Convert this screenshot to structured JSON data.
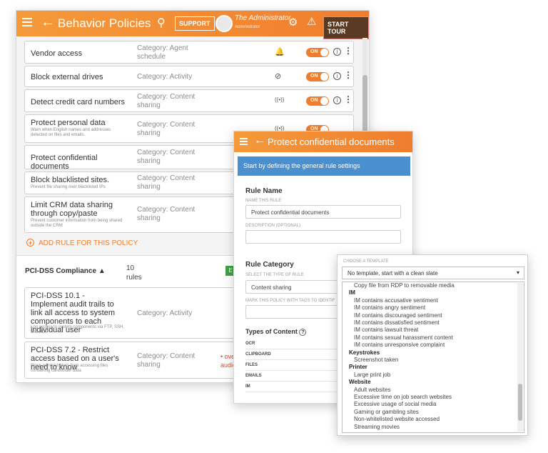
{
  "main": {
    "title": "Behavior Policies",
    "support": "SUPPORT",
    "user_name": "The Administrator",
    "user_role": "Administrator",
    "start_tour": "START TOUR",
    "toggle_label": "ON",
    "rules": [
      {
        "name": "Vendor access",
        "desc": "",
        "category": "Category: Agent schedule",
        "icon": "bell-icon",
        "glyph": "△"
      },
      {
        "name": "Block external drives",
        "desc": "",
        "category": "Category: Activity",
        "icon": "block-icon",
        "glyph": "⊘"
      },
      {
        "name": "Detect credit card numbers",
        "desc": "",
        "category": "Category: Content sharing",
        "icon": "broadcast-icon",
        "glyph": "((•))"
      },
      {
        "name": "Protect personal data",
        "desc": "Warn when English names and addresses detected on files and emails.",
        "category": "Category: Content sharing",
        "icon": "broadcast-icon",
        "glyph": "((•))"
      },
      {
        "name": "Protect confidential documents",
        "desc": "",
        "category": "Category: Content sharing",
        "icon": "",
        "glyph": ""
      },
      {
        "name": "Block blacklisted sites.",
        "desc": "Prevent file sharing over blacklisted IPs",
        "category": "Category: Content sharing",
        "icon": "",
        "glyph": ""
      },
      {
        "name": "Limit CRM data sharing through copy/paste",
        "desc": "Prevent customer information from being shared outside the CRM",
        "category": "Category: Content sharing",
        "icon": "",
        "glyph": ""
      }
    ],
    "add_rule": "ADD RULE FOR THIS POLICY",
    "policy_title": "PCI-DSS Compliance",
    "policy_rule_count": "10",
    "policy_rules_word": "rules",
    "policy_button": "E",
    "policy_rules": [
      {
        "name": "PCI-DSS 10.1 - Implement audit trails to link all access to system components to each individual user",
        "desc": "Log access to system components via FTP, SSH, and RDP",
        "category": "Category: Activity",
        "note": ""
      },
      {
        "name": "PCI-DSS 7.2 - Restrict access based on a user's need to know",
        "desc": "Block administrators from accessing files containing cardholder data",
        "category": "Category: Content sharing",
        "note": "• overri audienc"
      }
    ]
  },
  "rule_editor": {
    "title": "Protect confidential documents",
    "banner": "Start by defining the general rule settings",
    "rule_name_header": "Rule Name",
    "name_label": "NAME THIS RULE",
    "name_value": "Protect confidential documents",
    "desc_label": "DESCRIPTION (OPTIONAL)",
    "desc_value": "",
    "category_header": "Rule Category",
    "category_label": "SELECT THE TYPE OF RULE",
    "category_value": "Content sharing",
    "tags_label": "MARK THIS POLICY WITH TAGS TO IDENTIF",
    "types_header": "Types of Content",
    "types": [
      "OCR",
      "CLIPBOARD",
      "FILES",
      "EMAILS",
      "IM"
    ]
  },
  "template_picker": {
    "label": "CHOOSE A TEMPLATE",
    "selected": "No template, start with a clean slate",
    "items": [
      {
        "text": "Copy file from RDP to removable media",
        "group": false
      },
      {
        "text": "IM",
        "group": true
      },
      {
        "text": "IM contains accusative sentiment",
        "group": false
      },
      {
        "text": "IM contains angry sentiment",
        "group": false
      },
      {
        "text": "IM contains discouraged sentiment",
        "group": false
      },
      {
        "text": "IM contains dissatisfied sentiment",
        "group": false
      },
      {
        "text": "IM contains lawsuit threat",
        "group": false
      },
      {
        "text": "IM contains sexual harassment content",
        "group": false
      },
      {
        "text": "IM contains unresponsive complaint",
        "group": false
      },
      {
        "text": "Keystrokes",
        "group": true
      },
      {
        "text": "Screenshot taken",
        "group": false
      },
      {
        "text": "Printer",
        "group": true
      },
      {
        "text": "Large print job",
        "group": false
      },
      {
        "text": "Website",
        "group": true
      },
      {
        "text": "Adult websites",
        "group": false
      },
      {
        "text": "Excessive time on job search websites",
        "group": false
      },
      {
        "text": "Excessive usage of social media",
        "group": false
      },
      {
        "text": "Gaming or gambling sites",
        "group": false
      },
      {
        "text": "Non-whitelisted website accessed",
        "group": false
      },
      {
        "text": "Streaming movies",
        "group": false
      }
    ]
  },
  "colors": {
    "accent": "#f07d2e",
    "banner": "#4a90d0"
  }
}
